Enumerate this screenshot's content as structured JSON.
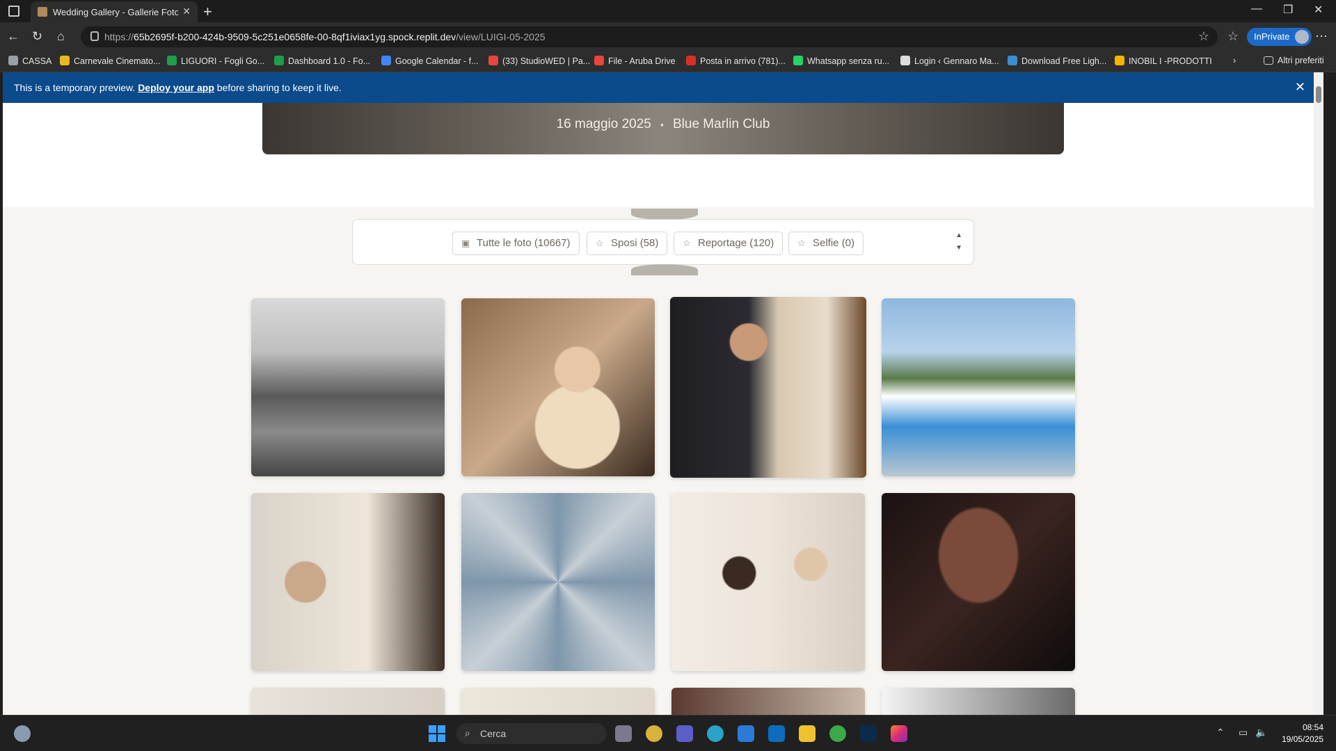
{
  "browser": {
    "tab_title": "Wedding Gallery - Gallerie Fotogr",
    "url_prefix": "https://",
    "url_host": "65b2695f-b200-424b-9509-5c251e0658fe-00-8qf1iviax1yg.spock.replit.dev",
    "url_path": "/view/LUIGI-05-2025",
    "inprivate_label": "InPrivate",
    "bookmarks": [
      {
        "label": "CASSA",
        "color": "#9aa0a6"
      },
      {
        "label": "Carnevale Cinemato...",
        "color": "#e8b923"
      },
      {
        "label": "LIGUORI - Fogli Go...",
        "color": "#1e9e4a"
      },
      {
        "label": "Dashboard 1.0 - Fo...",
        "color": "#1e9e4a"
      },
      {
        "label": "Google Calendar - f...",
        "color": "#4285f4"
      },
      {
        "label": "(33) StudioWED | Pa...",
        "color": "#e8453c"
      },
      {
        "label": "File - Aruba Drive",
        "color": "#e8453c"
      },
      {
        "label": "Posta in arrivo (781)...",
        "color": "#d93025"
      },
      {
        "label": "Whatsapp senza ru...",
        "color": "#25d366"
      },
      {
        "label": "Login ‹ Gennaro Ma...",
        "color": "#dddddd"
      },
      {
        "label": "Download Free Ligh...",
        "color": "#3b8fd1"
      },
      {
        "label": "INOBIL I -PRODOTTI",
        "color": "#f4b400"
      }
    ],
    "other_favorites": "Altri preferiti"
  },
  "banner": {
    "prefix": "This is a temporary preview.",
    "link": "Deploy your app",
    "suffix": "before sharing to keep it live."
  },
  "hero": {
    "date": "16 maggio 2025",
    "separator": "•",
    "venue": "Blue Marlin Club"
  },
  "filters": [
    {
      "label": "Tutte le foto (10667)",
      "icon": "image-icon"
    },
    {
      "label": "Sposi (58)",
      "icon": "star-icon"
    },
    {
      "label": "Reportage (120)",
      "icon": "star-icon"
    },
    {
      "label": "Selfie (0)",
      "icon": "star-icon"
    }
  ],
  "taskbar": {
    "search_placeholder": "Cerca",
    "time": "08:54",
    "date": "19/05/2025"
  }
}
